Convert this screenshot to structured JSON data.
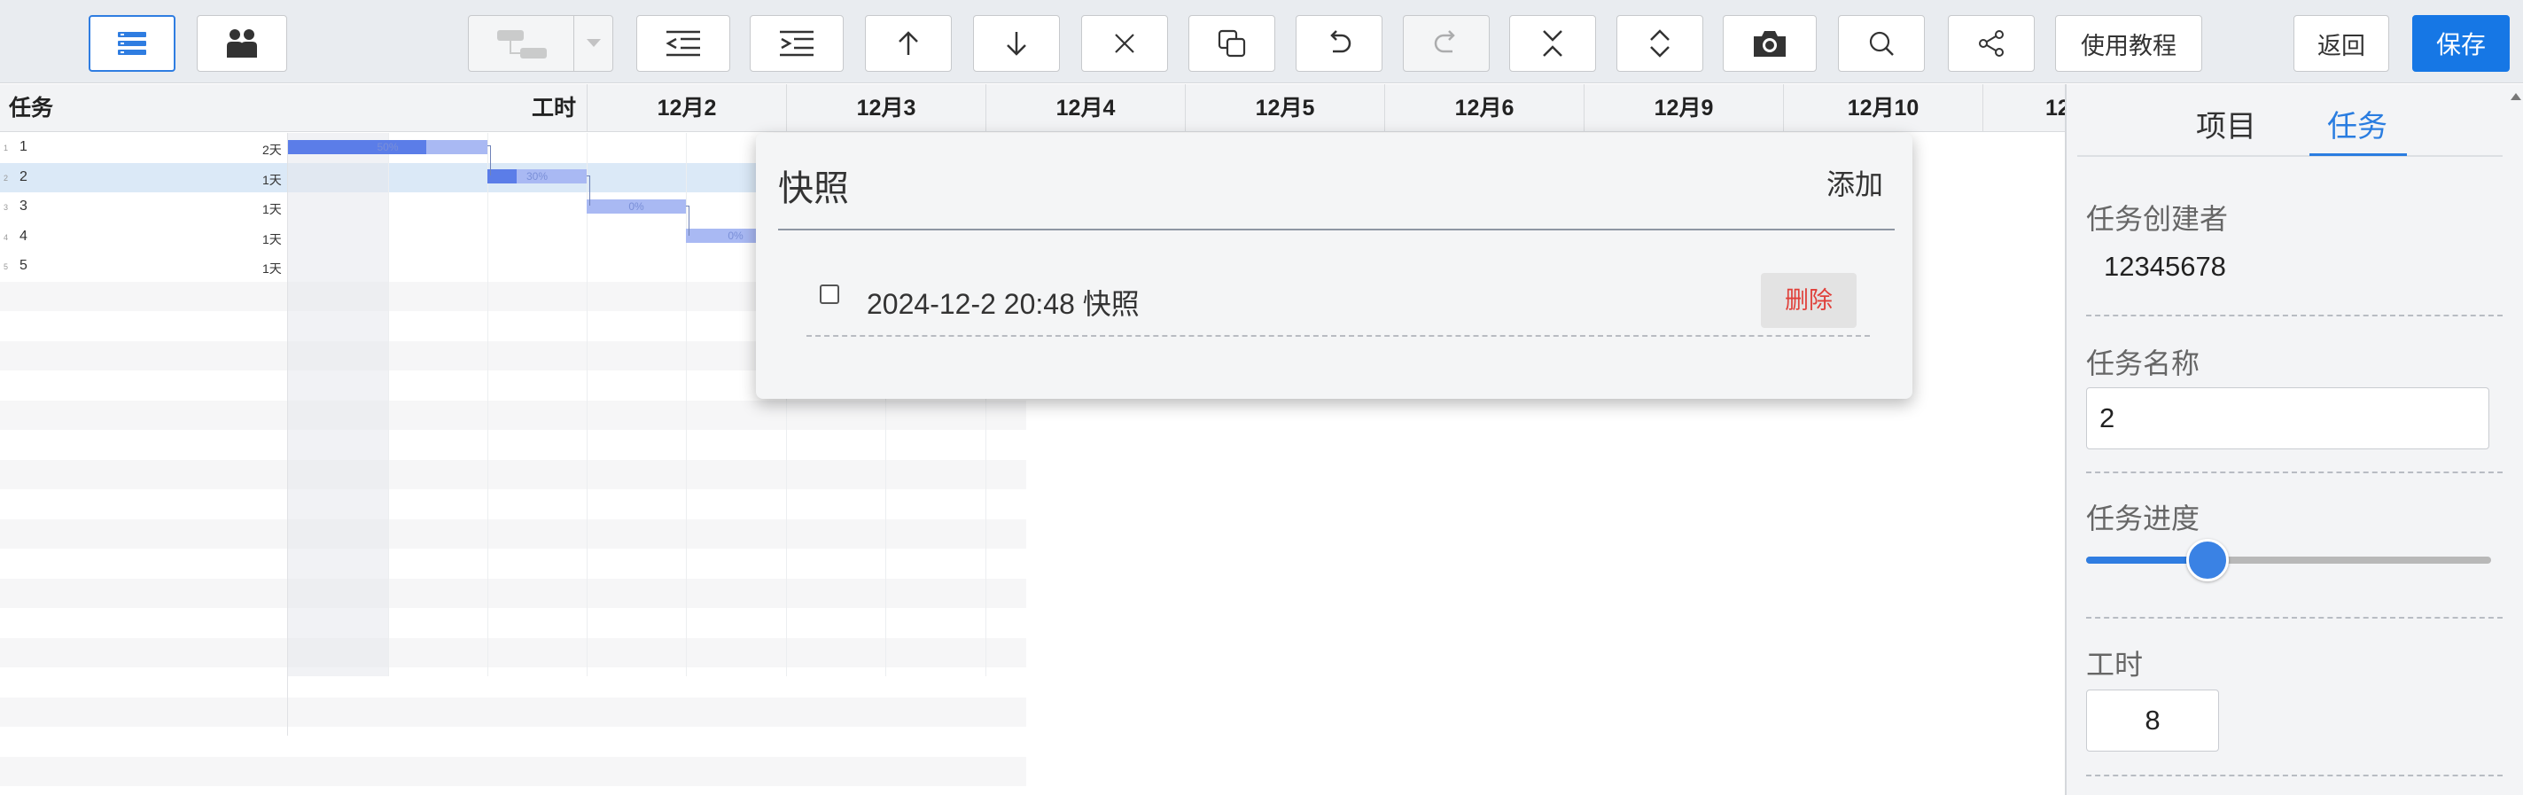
{
  "toolbar": {
    "left_buttons": [
      {
        "icon": "list-view-icon",
        "active": true
      },
      {
        "icon": "people-icon",
        "active": false
      }
    ],
    "actions": [
      {
        "icon": "link-task-icon",
        "disabled": true,
        "has_dropdown": true
      },
      {
        "icon": "outdent-icon"
      },
      {
        "icon": "indent-icon"
      },
      {
        "icon": "arrow-up-icon"
      },
      {
        "icon": "arrow-down-icon"
      },
      {
        "icon": "close-icon"
      },
      {
        "icon": "copy-icon"
      },
      {
        "icon": "undo-icon"
      },
      {
        "icon": "redo-icon",
        "disabled": true
      },
      {
        "icon": "collapse-icon"
      },
      {
        "icon": "expand-icon"
      },
      {
        "icon": "camera-icon"
      },
      {
        "icon": "search-icon"
      },
      {
        "icon": "share-icon"
      }
    ],
    "tutorial_label": "使用教程",
    "back_label": "返回",
    "save_label": "保存",
    "accent_color": "#1677e5"
  },
  "gantt": {
    "col_task": "任务",
    "col_hours": "工时",
    "dates": [
      "12月2",
      "12月3",
      "12月4",
      "12月5",
      "12月6",
      "12月9",
      "12月10",
      "12"
    ],
    "rows": [
      {
        "num": "1",
        "name": "1",
        "duration": "2天",
        "progress_label": "50%"
      },
      {
        "num": "2",
        "name": "2",
        "duration": "1天",
        "progress_label": "30%"
      },
      {
        "num": "3",
        "name": "3",
        "duration": "1天",
        "progress_label": "0%"
      },
      {
        "num": "4",
        "name": "4",
        "duration": "1天",
        "progress_label": "0%"
      },
      {
        "num": "5",
        "name": "5",
        "duration": "1天"
      }
    ]
  },
  "snapshot_popup": {
    "title": "快照",
    "add_label": "添加",
    "items": [
      {
        "label": "2024-12-2 20:48 快照",
        "checked": false,
        "delete_label": "删除"
      }
    ]
  },
  "panel": {
    "tabs": [
      {
        "label": "项目",
        "active": false
      },
      {
        "label": "任务",
        "active": true
      }
    ],
    "creator_label": "任务创建者",
    "creator_value": "12345678",
    "name_label": "任务名称",
    "name_value": "2",
    "progress_label": "任务进度",
    "progress_value": 30,
    "hours_label": "工时",
    "hours_value": "8"
  }
}
